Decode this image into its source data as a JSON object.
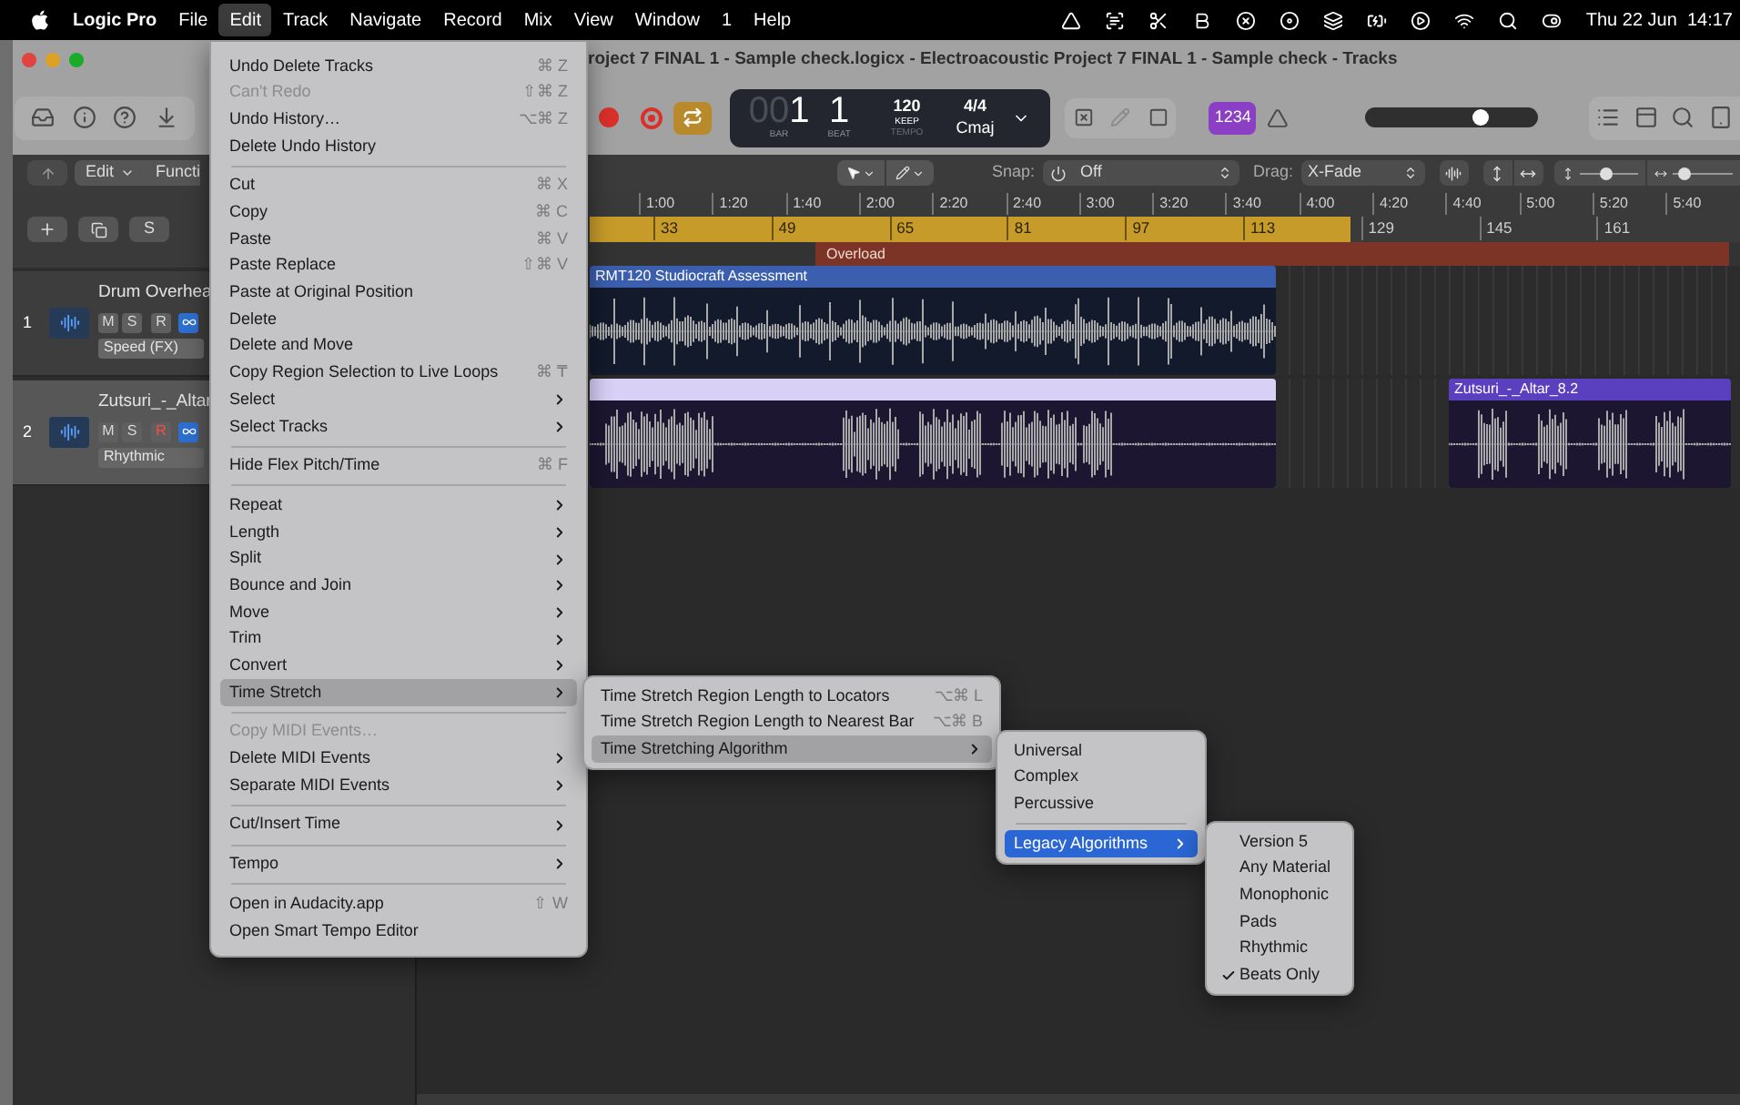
{
  "menu_bar": {
    "app": "Logic Pro",
    "items": [
      {
        "label": "File",
        "selected": false
      },
      {
        "label": "Edit",
        "selected": true
      },
      {
        "label": "Track",
        "selected": false
      },
      {
        "label": "Navigate",
        "selected": false
      },
      {
        "label": "Record",
        "selected": false
      },
      {
        "label": "Mix",
        "selected": false
      },
      {
        "label": "View",
        "selected": false
      },
      {
        "label": "Window",
        "selected": false
      },
      {
        "label": "1",
        "selected": false
      },
      {
        "label": "Help",
        "selected": false
      }
    ],
    "clock": "Thu 22 Jun  14:17"
  },
  "window": {
    "title": "roject 7 FINAL 1 - Sample check.logicx - Electroacoustic Project 7 FINAL 1 - Sample check - Tracks"
  },
  "toolbar": {
    "cycle": {
      "on": true
    },
    "lcd": {
      "bar": "001",
      "bar_label": "BAR",
      "beat": "1",
      "beat_label": "BEAT",
      "tempo": "120",
      "tempo_mode": "KEEP",
      "tempo_label": "TEMPO",
      "signature": "4/4",
      "key": "Cmaj"
    },
    "count_in": "1234",
    "master_volume": {
      "level": 0.66
    }
  },
  "track_list": {
    "solo_button": "S"
  },
  "control_bar": {
    "vertical_zoom": {
      "level": 0.45
    },
    "horizontal_zoom": {
      "level": 0.2
    },
    "edit": "Edit",
    "functions": "Functi",
    "snap_label": "Snap:",
    "snap": "Off",
    "drag_label": "Drag:",
    "drag": "X-Fade"
  },
  "ruler": {
    "times": [
      "1:00",
      "1:20",
      "1:40",
      "2:00",
      "2:20",
      "2:40",
      "3:00",
      "3:20",
      "3:40",
      "4:00",
      "4:20",
      "4:40",
      "5:00",
      "5:20",
      "5:40"
    ],
    "bars": [
      "33",
      "49",
      "65",
      "81",
      "97",
      "113",
      "129",
      "145",
      "161"
    ],
    "marker": "Overload"
  },
  "tracks": [
    {
      "number": "1",
      "name": "Drum Overhea",
      "buttons": [
        "M",
        "S",
        "R"
      ],
      "record_enabled": false,
      "flex_mode": "Speed (FX)",
      "selected": false,
      "regions": [
        {
          "name": "RMT120 Studiocraft Assessment",
          "color": "#3b5fae"
        }
      ]
    },
    {
      "number": "2",
      "name": "Zutsuri_-_Altar",
      "buttons": [
        "M",
        "S",
        "R"
      ],
      "record_enabled": true,
      "flex_mode": "Rhythmic",
      "selected": true,
      "regions": [
        {
          "color": "#d9d0f6"
        },
        {
          "name": "Zutsuri_-_Altar_8.2",
          "color": "#5a3fbf"
        }
      ]
    }
  ],
  "edit_menu": {
    "items": [
      {
        "kind": "item",
        "label": "Undo Delete Tracks",
        "shortcut": "⌘ Z",
        "submenu": false,
        "disabled": false,
        "selected": false
      },
      {
        "kind": "item",
        "label": "Can't Redo",
        "shortcut": "⇧⌘ Z",
        "submenu": false,
        "disabled": true,
        "selected": false
      },
      {
        "kind": "item",
        "label": "Undo History…",
        "shortcut": "⌥⌘ Z",
        "submenu": false,
        "disabled": false,
        "selected": false
      },
      {
        "kind": "item",
        "label": "Delete Undo History",
        "submenu": false,
        "disabled": false,
        "selected": false
      },
      {
        "kind": "separator"
      },
      {
        "kind": "item",
        "label": "Cut",
        "shortcut": "⌘ X",
        "submenu": false,
        "disabled": false,
        "selected": false
      },
      {
        "kind": "item",
        "label": "Copy",
        "shortcut": "⌘ C",
        "submenu": false,
        "disabled": false,
        "selected": false
      },
      {
        "kind": "item",
        "label": "Paste",
        "shortcut": "⌘ V",
        "submenu": false,
        "disabled": false,
        "selected": false
      },
      {
        "kind": "item",
        "label": "Paste Replace",
        "shortcut": "⇧⌘ V",
        "submenu": false,
        "disabled": false,
        "selected": false
      },
      {
        "kind": "item",
        "label": "Paste at Original Position",
        "submenu": false,
        "disabled": false,
        "selected": false
      },
      {
        "kind": "item",
        "label": "Delete",
        "submenu": false,
        "disabled": false,
        "selected": false
      },
      {
        "kind": "item",
        "label": "Delete and Move",
        "submenu": false,
        "disabled": false,
        "selected": false
      },
      {
        "kind": "item",
        "label": "Copy Region Selection to Live Loops",
        "shortcut": "⌘ ₸",
        "submenu": false,
        "disabled": false,
        "selected": false
      },
      {
        "kind": "item",
        "label": "Select",
        "submenu": true,
        "disabled": false,
        "selected": false
      },
      {
        "kind": "item",
        "label": "Select Tracks",
        "submenu": true,
        "disabled": false,
        "selected": false
      },
      {
        "kind": "separator"
      },
      {
        "kind": "item",
        "label": "Hide Flex Pitch/Time",
        "shortcut": "⌘ F",
        "submenu": false,
        "disabled": false,
        "selected": false
      },
      {
        "kind": "separator"
      },
      {
        "kind": "item",
        "label": "Repeat",
        "submenu": true,
        "disabled": false,
        "selected": false
      },
      {
        "kind": "item",
        "label": "Length",
        "submenu": true,
        "disabled": false,
        "selected": false
      },
      {
        "kind": "item",
        "label": "Split",
        "submenu": true,
        "disabled": false,
        "selected": false
      },
      {
        "kind": "item",
        "label": "Bounce and Join",
        "submenu": true,
        "disabled": false,
        "selected": false
      },
      {
        "kind": "item",
        "label": "Move",
        "submenu": true,
        "disabled": false,
        "selected": false
      },
      {
        "kind": "item",
        "label": "Trim",
        "submenu": true,
        "disabled": false,
        "selected": false
      },
      {
        "kind": "item",
        "label": "Convert",
        "submenu": true,
        "disabled": false,
        "selected": false
      },
      {
        "kind": "item",
        "label": "Time Stretch",
        "submenu": true,
        "disabled": false,
        "selected": true
      },
      {
        "kind": "separator"
      },
      {
        "kind": "item",
        "label": "Copy MIDI Events…",
        "submenu": false,
        "disabled": true,
        "selected": false
      },
      {
        "kind": "item",
        "label": "Delete MIDI Events",
        "submenu": true,
        "disabled": false,
        "selected": false
      },
      {
        "kind": "item",
        "label": "Separate MIDI Events",
        "submenu": true,
        "disabled": false,
        "selected": false
      },
      {
        "kind": "separator"
      },
      {
        "kind": "item",
        "label": "Cut/Insert Time",
        "submenu": true,
        "disabled": false,
        "selected": false
      },
      {
        "kind": "separator"
      },
      {
        "kind": "item",
        "label": "Tempo",
        "submenu": true,
        "disabled": false,
        "selected": false
      },
      {
        "kind": "separator"
      },
      {
        "kind": "item",
        "label": "Open in Audacity.app",
        "shortcut": "⇧ W",
        "submenu": false,
        "disabled": false,
        "selected": false
      },
      {
        "kind": "item",
        "label": "Open Smart Tempo Editor",
        "submenu": false,
        "disabled": false,
        "selected": false
      }
    ]
  },
  "submenus": [
    {
      "active": false,
      "items": [
        {
          "kind": "item",
          "label": "Time Stretch Region Length to Locators",
          "shortcut": "⌥⌘ L",
          "submenu": false,
          "selected": false
        },
        {
          "kind": "item",
          "label": "Time Stretch Region Length to Nearest Bar",
          "shortcut": "⌥⌘ B",
          "submenu": false,
          "selected": false
        },
        {
          "kind": "item",
          "label": "Time Stretching Algorithm",
          "submenu": true,
          "selected": true
        }
      ]
    },
    {
      "active": true,
      "items": [
        {
          "kind": "item",
          "label": "Universal",
          "submenu": false,
          "selected": false
        },
        {
          "kind": "item",
          "label": "Complex",
          "submenu": false,
          "selected": false
        },
        {
          "kind": "item",
          "label": "Percussive",
          "submenu": false,
          "selected": false
        },
        {
          "kind": "separator"
        },
        {
          "kind": "item",
          "label": "Legacy Algorithms",
          "submenu": true,
          "selected": true
        }
      ]
    },
    {
      "active": false,
      "items": [
        {
          "kind": "item",
          "label": "Version 5",
          "submenu": false,
          "selected": false,
          "checked": false
        },
        {
          "kind": "item",
          "label": "Any Material",
          "submenu": false,
          "selected": false,
          "checked": false
        },
        {
          "kind": "item",
          "label": "Monophonic",
          "submenu": false,
          "selected": false,
          "checked": false
        },
        {
          "kind": "item",
          "label": "Pads",
          "submenu": false,
          "selected": false,
          "checked": false
        },
        {
          "kind": "item",
          "label": "Rhythmic",
          "submenu": false,
          "selected": false,
          "checked": false
        },
        {
          "kind": "item",
          "label": "Beats Only",
          "submenu": false,
          "selected": false,
          "checked": true
        }
      ]
    }
  ]
}
